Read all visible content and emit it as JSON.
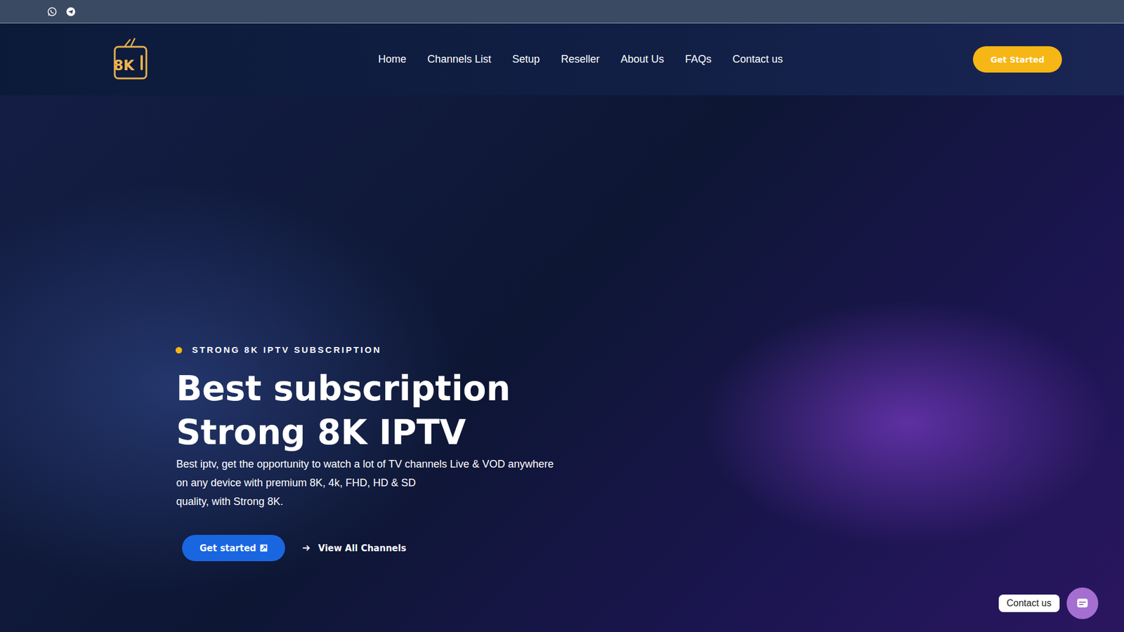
{
  "logo": {
    "text": "8K"
  },
  "nav": {
    "items": [
      {
        "label": "Home"
      },
      {
        "label": "Channels List"
      },
      {
        "label": "Setup"
      },
      {
        "label": "Reseller"
      },
      {
        "label": "About Us"
      },
      {
        "label": "FAQs"
      },
      {
        "label": "Contact us"
      }
    ]
  },
  "header_button": {
    "label": "Get Started"
  },
  "hero": {
    "eyebrow": "STRONG 8K IPTV SUBSCRIPTION",
    "title_lines": [
      "Best subscription",
      "Strong 8K IPTV"
    ],
    "description_lines": [
      "Best iptv, get the opportunity to watch a lot of TV channels Live & VOD anywhere",
      "on any device with premium 8K, 4k, FHD, HD & SD",
      "quality, with Strong 8K."
    ],
    "primary_button": {
      "label": "Get started"
    },
    "secondary_link": {
      "label": "View All Channels"
    }
  },
  "contact_widget": {
    "label": "Contact us"
  }
}
